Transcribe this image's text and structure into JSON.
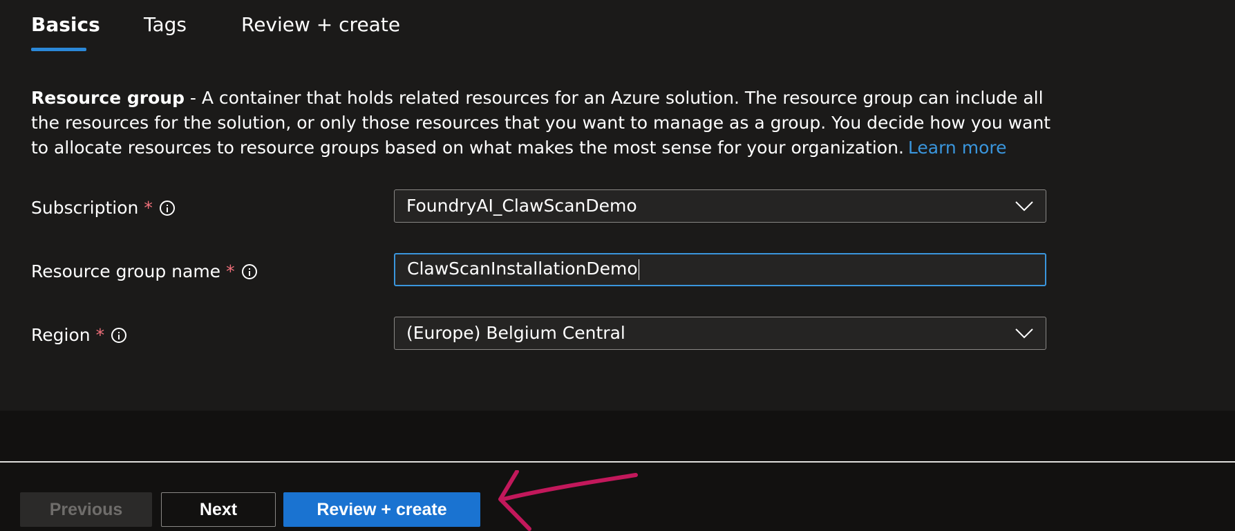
{
  "tabs": [
    {
      "label": "Basics",
      "active": true
    },
    {
      "label": "Tags",
      "active": false
    },
    {
      "label": "Review + create",
      "active": false
    }
  ],
  "description": {
    "title": "Resource group",
    "text": " - A container that holds related resources for an Azure solution. The resource group can include all the resources for the solution, or only those resources that you want to manage as a group. You decide how you want to allocate resources to resource groups based on what makes the most sense for your organization.",
    "link": "Learn more"
  },
  "form": {
    "subscription": {
      "label": "Subscription",
      "required": "*",
      "value": "FoundryAI_ClawScanDemo"
    },
    "resource_group": {
      "label": "Resource group name",
      "required": "*",
      "value": "ClawScanInstallationDemo"
    },
    "region": {
      "label": "Region",
      "required": "*",
      "value": "(Europe) Belgium Central"
    }
  },
  "footer": {
    "previous": "Previous",
    "next": "Next",
    "review_create": "Review + create"
  },
  "colors": {
    "accent": "#2b88d8",
    "primary_button": "#1a73d1",
    "required": "#f1707b",
    "annotation_arrow": "#c2185b"
  }
}
